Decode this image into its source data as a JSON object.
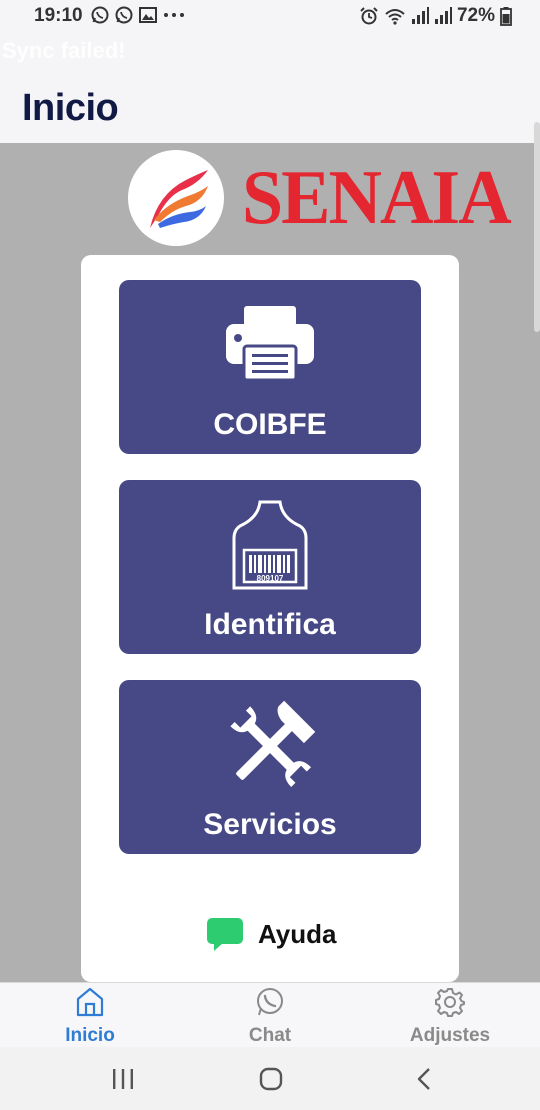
{
  "status_bar": {
    "time": "19:10",
    "battery": "72%",
    "left_icons": [
      "whatsapp-icon",
      "whatsapp-icon",
      "image-icon",
      "more-icon"
    ],
    "right_icons": [
      "alarm-icon",
      "wifi-icon",
      "signal-icon",
      "signal-icon",
      "battery-icon"
    ]
  },
  "sync_banner": {
    "text": "Sync failed!"
  },
  "header": {
    "title": "Inicio"
  },
  "brand": {
    "name": "SENAIA",
    "color": "#e3262f",
    "logo_icon": "feather-logo-icon"
  },
  "menu": [
    {
      "label": "COIBFE",
      "icon": "printer-icon"
    },
    {
      "label": "Identifica",
      "icon": "ear-tag-barcode-icon",
      "tag_number": "809107"
    },
    {
      "label": "Servicios",
      "icon": "tools-icon"
    }
  ],
  "help": {
    "label": "Ayuda",
    "icon": "chat-bubble-icon",
    "icon_color": "#2ecc71"
  },
  "bottom_nav": {
    "active_color": "#2f7cd4",
    "inactive_color": "#8a8a8a",
    "items": [
      {
        "label": "Inicio",
        "icon": "home-icon",
        "active": true
      },
      {
        "label": "Chat",
        "icon": "whatsapp-icon",
        "active": false
      },
      {
        "label": "Adjustes",
        "icon": "gear-icon",
        "active": false
      }
    ]
  },
  "system_nav": {
    "buttons": [
      "recents-icon",
      "home-circle-icon",
      "back-icon"
    ]
  },
  "colors": {
    "button_bg": "#474986",
    "background": "#b0b0b0",
    "title": "#111a44"
  }
}
